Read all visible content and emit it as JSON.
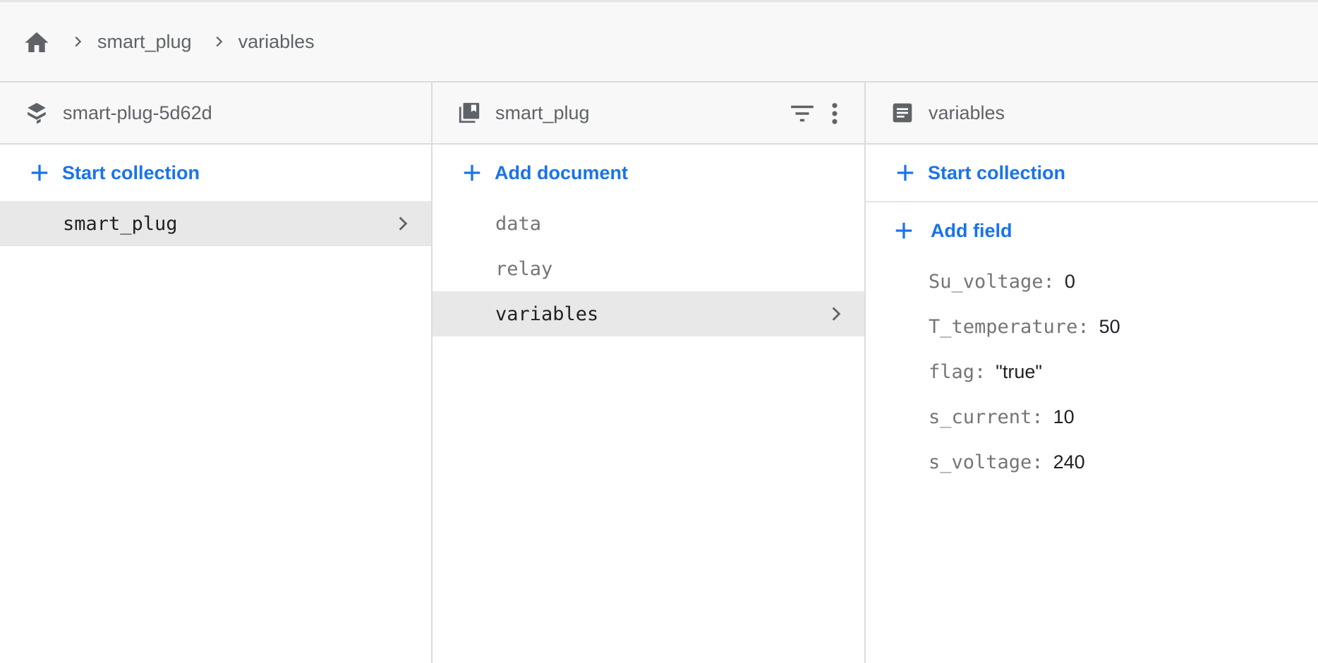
{
  "breadcrumb": {
    "home_icon": "home-icon",
    "items": [
      "smart_plug",
      "variables"
    ]
  },
  "columns": {
    "project": {
      "icon": "firestore-layers-icon",
      "title": "smart-plug-5d62d",
      "action_label": "Start collection",
      "items": [
        "smart_plug"
      ],
      "selected": "smart_plug"
    },
    "collection": {
      "icon": "collection-icon",
      "title": "smart_plug",
      "action_label": "Add document",
      "filter_icon": "filter-icon",
      "more_icon": "more-vert-icon",
      "items": [
        "data",
        "relay",
        "variables"
      ],
      "selected": "variables"
    },
    "document": {
      "icon": "document-icon",
      "title": "variables",
      "start_collection_label": "Start collection",
      "add_field_label": "Add field",
      "fields": [
        {
          "key": "Su_voltage:",
          "value": "0"
        },
        {
          "key": "T_temperature:",
          "value": "50"
        },
        {
          "key": "flag:",
          "value": "\"true\""
        },
        {
          "key": "s_current:",
          "value": "10"
        },
        {
          "key": "s_voltage:",
          "value": "240"
        }
      ]
    }
  },
  "colors": {
    "accent": "#1a73e8",
    "selected_bg": "#e8e8e8",
    "header_bg": "#f8f8f8"
  }
}
